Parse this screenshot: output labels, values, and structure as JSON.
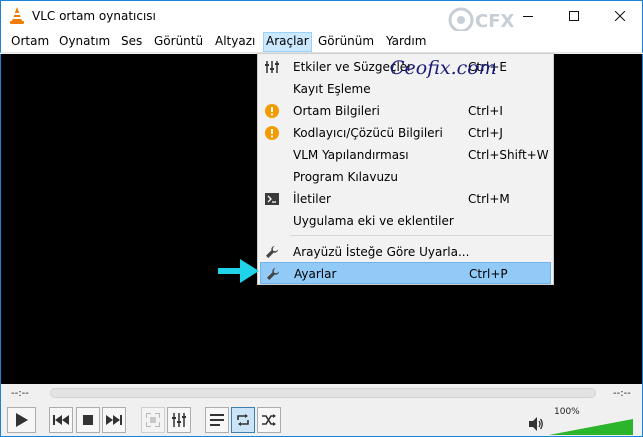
{
  "window": {
    "title": "VLC ortam oynatıcısı",
    "minimize_glyph": "—",
    "maximize_glyph": "☐",
    "close_glyph": "✕"
  },
  "menubar": {
    "items": [
      "Ortam",
      "Oynatım",
      "Ses",
      "Görüntü",
      "Altyazı",
      "Araçlar",
      "Görünüm",
      "Yardım"
    ],
    "active": "Araçlar"
  },
  "tools_menu": {
    "items": [
      {
        "label": "Etkiler ve Süzgeçler",
        "shortcut": "Ctrl+E",
        "icon": "sliders-icon"
      },
      {
        "label": "Kayıt Eşleme",
        "shortcut": "",
        "icon": ""
      },
      {
        "label": "Ortam Bilgileri",
        "shortcut": "Ctrl+I",
        "icon": "info-icon"
      },
      {
        "label": "Kodlayıcı/Çözücü Bilgileri",
        "shortcut": "Ctrl+J",
        "icon": "info-icon"
      },
      {
        "label": "VLM Yapılandırması",
        "shortcut": "Ctrl+Shift+W",
        "icon": ""
      },
      {
        "label": "Program Kılavuzu",
        "shortcut": "",
        "icon": ""
      },
      {
        "label": "İletiler",
        "shortcut": "Ctrl+M",
        "icon": "terminal-icon"
      },
      {
        "label": "Uygulama eki ve eklentiler",
        "shortcut": "",
        "icon": ""
      },
      {
        "label": "Arayüzü İsteğe Göre Uyarla...",
        "shortcut": "",
        "icon": "wrench-icon"
      },
      {
        "label": "Ayarlar",
        "shortcut": "Ctrl+P",
        "icon": "wrench-icon"
      }
    ],
    "highlighted": "Ayarlar"
  },
  "watermark": {
    "text": "Ceofix.com",
    "logo_text": "CFX"
  },
  "seek": {
    "elapsed": "--:--",
    "remaining": "--:--",
    "progress": 0
  },
  "volume": {
    "label": "100%",
    "level": 1.0
  },
  "colors": {
    "accent": "#1883d7",
    "menu_highlight": "#91c9f7",
    "arrow": "#1fd3e8",
    "video_bg": "#000000",
    "volume_green": "#2bb52b"
  }
}
